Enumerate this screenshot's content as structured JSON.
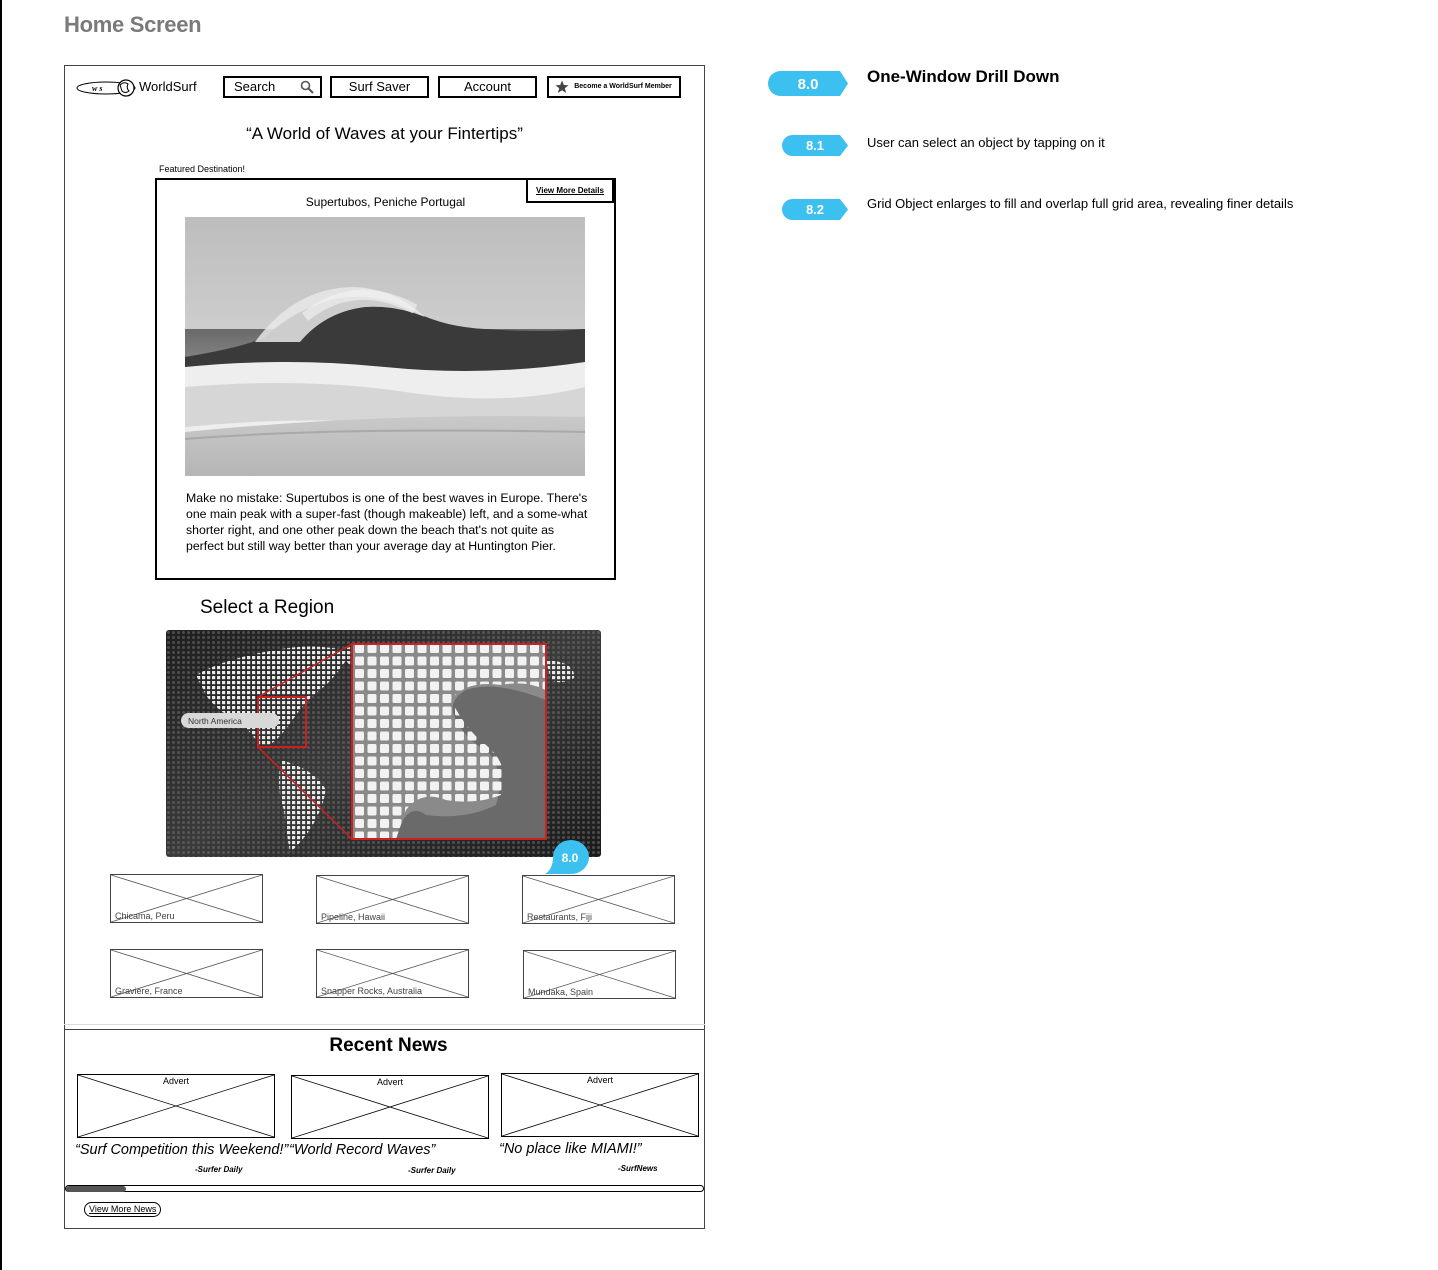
{
  "page": {
    "title": "Home Screen"
  },
  "header": {
    "logo_initials": "w s",
    "logo_text": "WorldSurf",
    "search_label": "Search",
    "surf_saver_label": "Surf Saver",
    "account_label": "Account",
    "member_label": "Become a WorldSurf Member"
  },
  "tagline": "“A World of Waves at your Fintertips”",
  "featured": {
    "label": "Featured Destination!",
    "view_more": "View More Details",
    "title": "Supertubos, Peniche Portugal",
    "description": "Make no mistake: Supertubos is one of the best waves in Europe. There's one main peak with a super-fast (though makeable) left, and a some-what shorter right, and one other peak down the beach that's not quite as perfect but still way better than your average day at Huntington Pier."
  },
  "region": {
    "title": "Select a Region",
    "hover_label": "North America",
    "callout": "8.0"
  },
  "destinations": [
    "Chicama, Peru",
    "Pipeline, Hawaii",
    "Restaurants, Fiji",
    "Graviere, France",
    "Snapper Rocks, Australia",
    "Mundaka, Spain"
  ],
  "news": {
    "title": "Recent News",
    "items": [
      {
        "advert": "Advert",
        "quote": "“Surf Competition this Weekend!”",
        "source": "-Surfer Daily"
      },
      {
        "advert": "Advert",
        "quote": "“World Record Waves”",
        "source": "-Surfer Daily"
      },
      {
        "advert": "Advert",
        "quote": "“No place like MIAMI!”",
        "source": "-SurfNews"
      }
    ],
    "view_more": "View More News"
  },
  "annotations": {
    "color": "#3cc0f0",
    "items": [
      {
        "num": "8.0",
        "text": "One-Window Drill Down"
      },
      {
        "num": "8.1",
        "text": "User can select an object by tapping on it"
      },
      {
        "num": "8.2",
        "text": "Grid Object enlarges to fill and overlap full grid area, revealing finer details"
      }
    ]
  }
}
